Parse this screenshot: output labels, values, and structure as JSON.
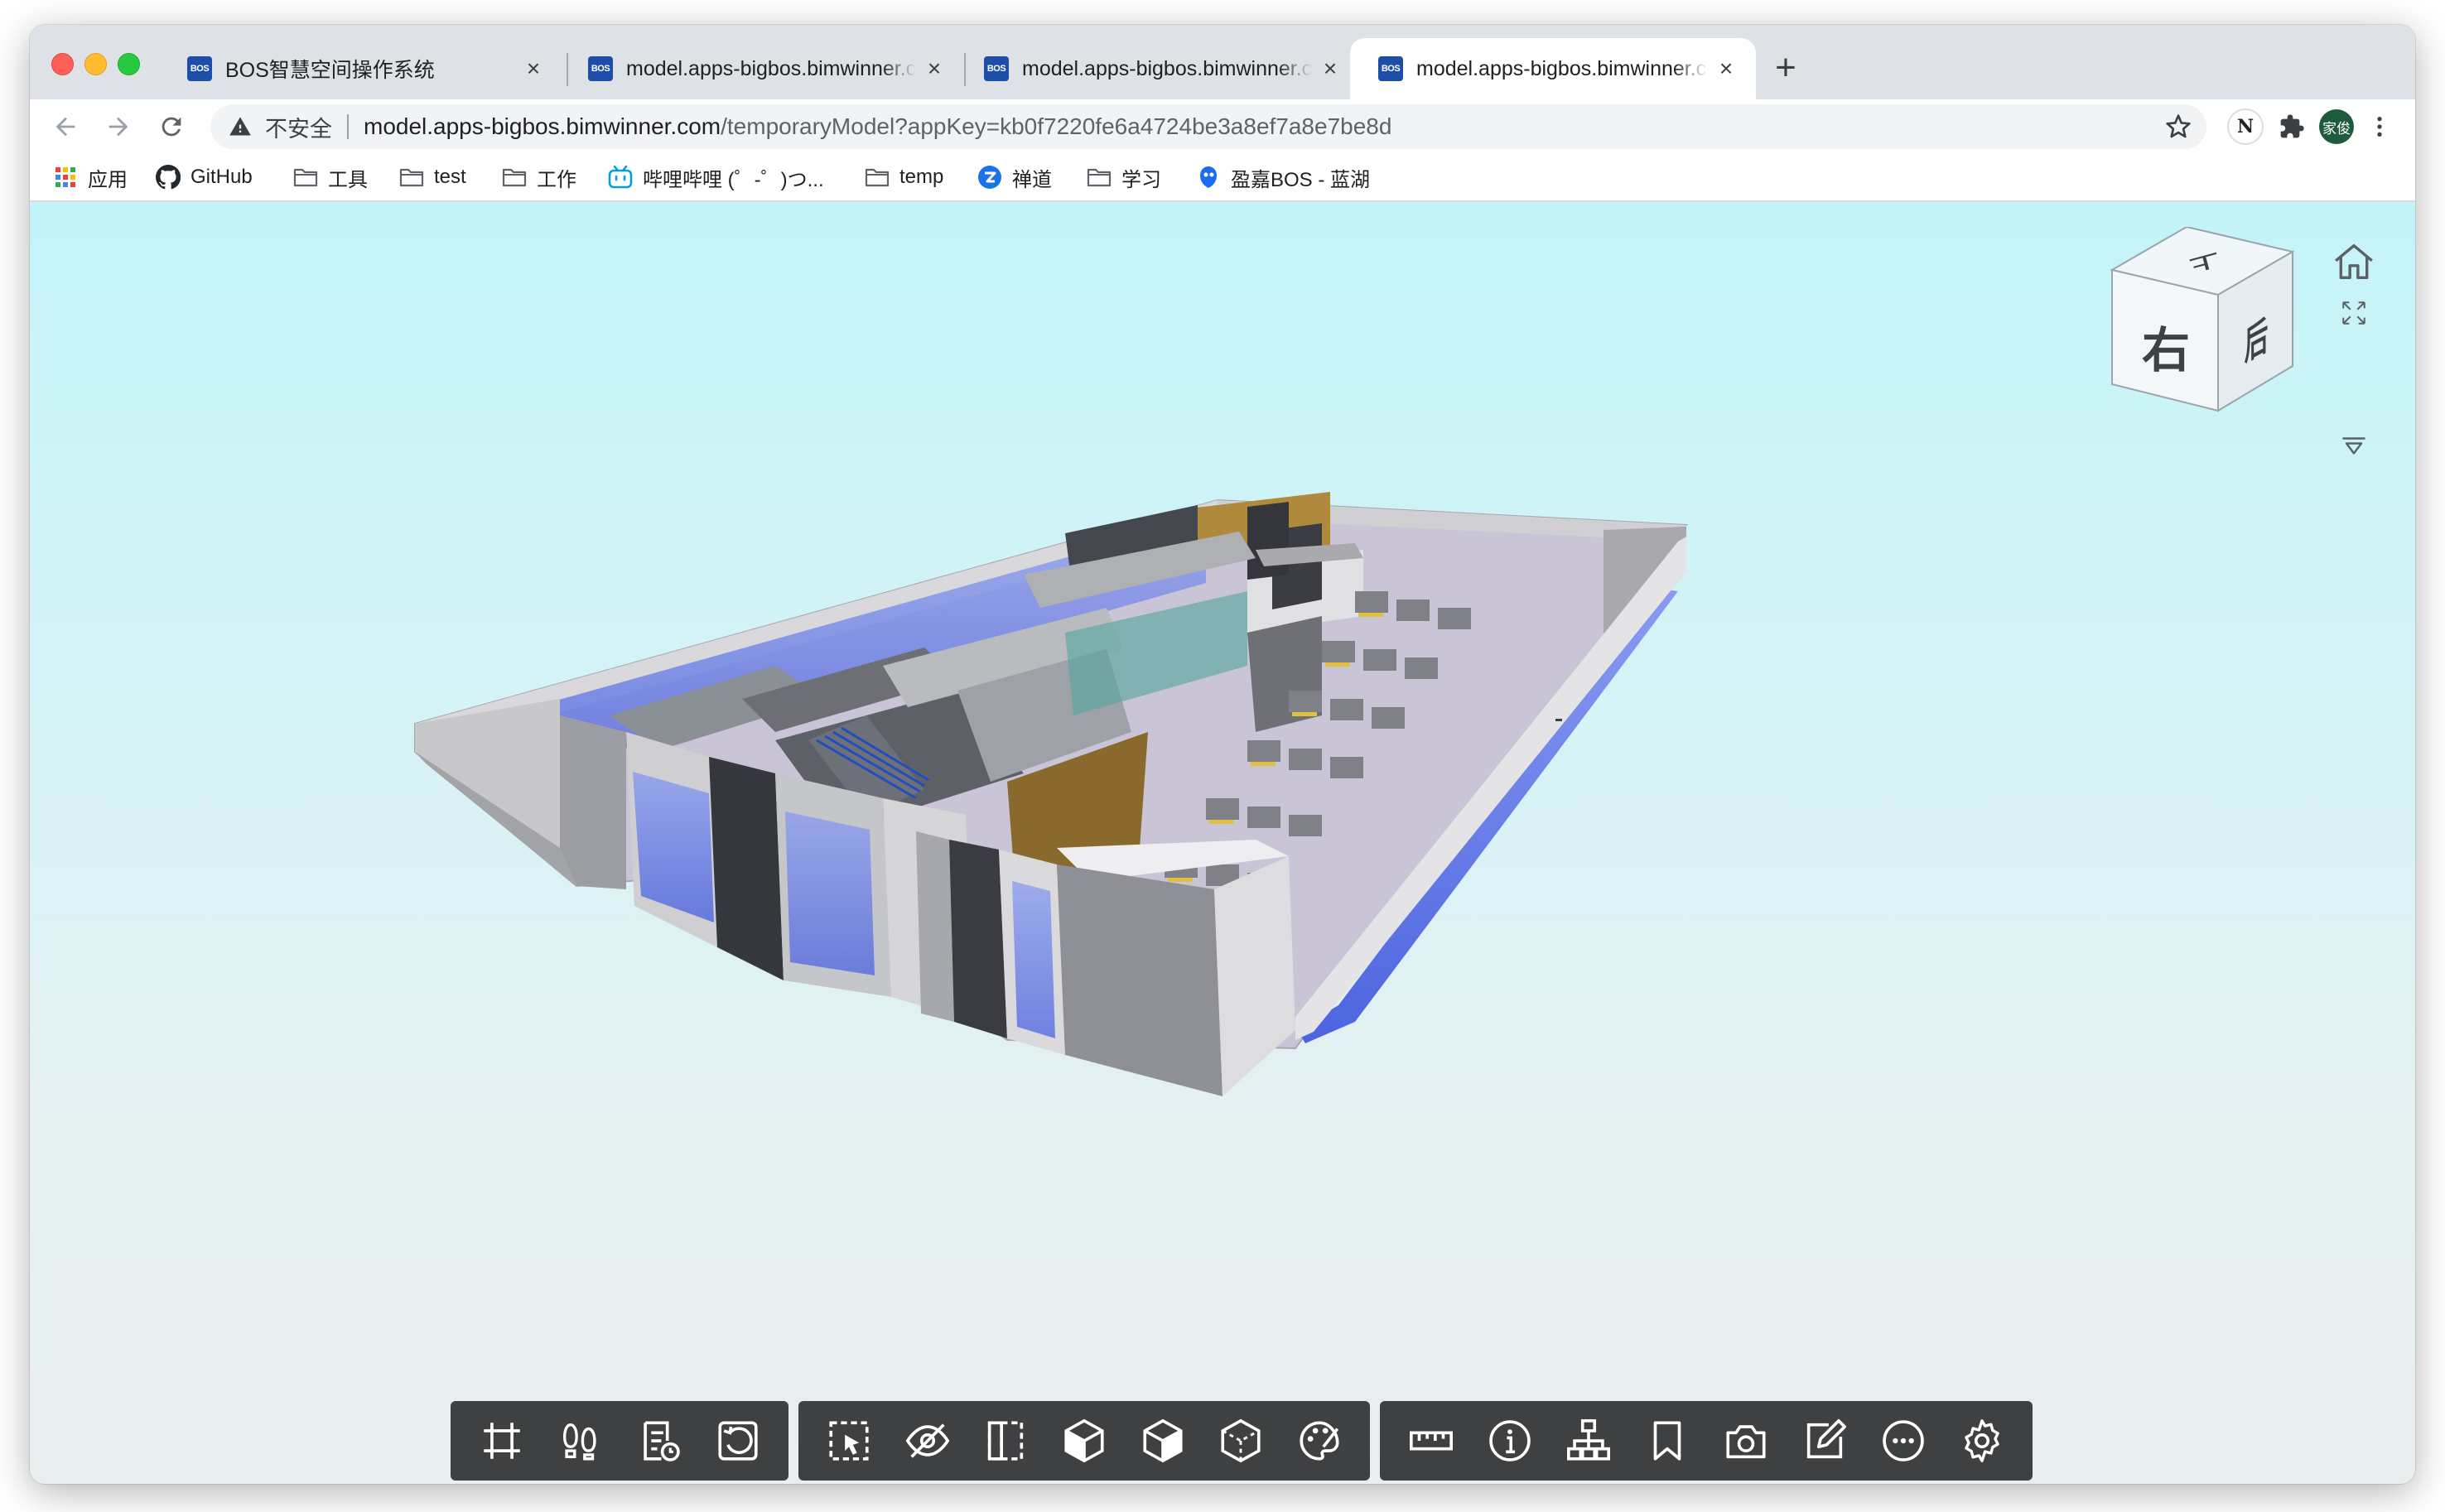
{
  "browser": {
    "tabs": [
      {
        "title": "BOS智慧空间操作系统",
        "favicon": "BOS",
        "active": false
      },
      {
        "title": "model.apps-bigbos.bimwinner.com",
        "favicon": "BOS",
        "active": false
      },
      {
        "title": "model.apps-bigbos.bimwinner.com",
        "favicon": "BOS",
        "active": false
      },
      {
        "title": "model.apps-bigbos.bimwinner.com",
        "favicon": "BOS",
        "active": true
      }
    ],
    "new_tab_glyph": "+",
    "close_glyph": "×",
    "security_label": "不安全",
    "url_host": "model.apps-bigbos.bimwinner.com",
    "url_path": "/temporaryModel?appKey=kb0f7220fe6a4724be3a8ef7a8e7be8d",
    "profile_avatar_text": "家俊",
    "extension_badge": "N"
  },
  "bookmarks": [
    {
      "label": "应用",
      "icon": "apps-grid-icon"
    },
    {
      "label": "GitHub",
      "icon": "github-icon"
    },
    {
      "label": "工具",
      "icon": "folder-icon"
    },
    {
      "label": "test",
      "icon": "folder-icon"
    },
    {
      "label": "工作",
      "icon": "folder-icon"
    },
    {
      "label": "哔哩哔哩 (゜-゜)つ...",
      "icon": "bilibili-icon"
    },
    {
      "label": "temp",
      "icon": "folder-icon"
    },
    {
      "label": "禅道",
      "icon": "zentao-icon"
    },
    {
      "label": "学习",
      "icon": "folder-icon"
    },
    {
      "label": "盈嘉BOS - 蓝湖",
      "icon": "lanhu-icon"
    }
  ],
  "viewcube": {
    "front_face": "右",
    "side_face": "后",
    "top_face": "上"
  },
  "toolbar_groups": [
    {
      "items": [
        "fit-view",
        "roam",
        "section-list",
        "reset-view"
      ]
    },
    {
      "items": [
        "box-select",
        "hide",
        "isolate-box",
        "section-box",
        "explode",
        "wireframe-box",
        "palette"
      ]
    },
    {
      "items": [
        "measure",
        "properties",
        "model-tree",
        "bookmark",
        "snapshot",
        "annotate",
        "more",
        "settings"
      ]
    }
  ],
  "colors": {
    "accent_blue": "#1f4ea8",
    "toolbar_bg": "#3f4042",
    "viewer_top": "#c4f4f8",
    "viewer_bottom": "#e9eeef"
  }
}
